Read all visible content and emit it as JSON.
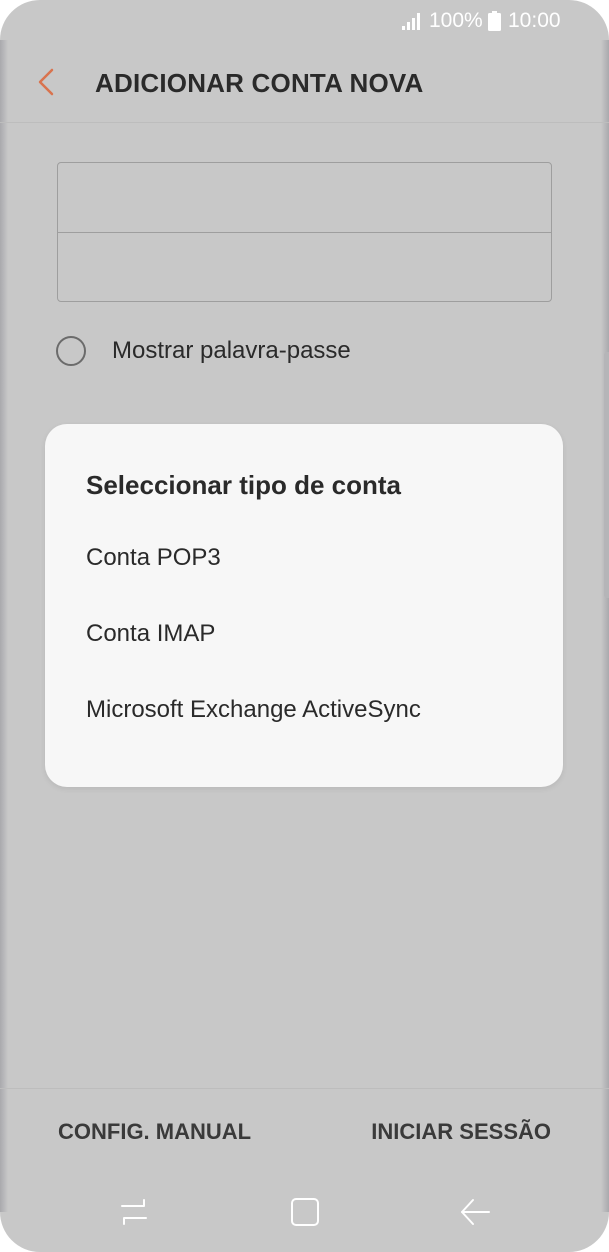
{
  "status_bar": {
    "battery": "100%",
    "time": "10:00"
  },
  "header": {
    "title": "ADICIONAR CONTA NOVA"
  },
  "form": {
    "email_value": "",
    "password_value": "",
    "show_password_label": "Mostrar palavra-passe"
  },
  "dialog": {
    "title": "Seleccionar tipo de conta",
    "options": [
      {
        "label": "Conta POP3"
      },
      {
        "label": "Conta IMAP"
      },
      {
        "label": "Microsoft Exchange ActiveSync"
      }
    ]
  },
  "actions": {
    "manual_label": "CONFIG. MANUAL",
    "login_label": "INICIAR SESSÃO"
  },
  "colors": {
    "accent": "#d9734e",
    "scrim_background": "#c8c8c8",
    "dialog_background": "#f7f7f7",
    "text": "#2a2a2a"
  },
  "icons": {
    "back": "chevron-left-icon",
    "signal": "signal-icon",
    "battery": "battery-icon",
    "recent_apps": "recent-apps-icon",
    "home": "home-icon",
    "nav_back": "back-arrow-icon"
  }
}
